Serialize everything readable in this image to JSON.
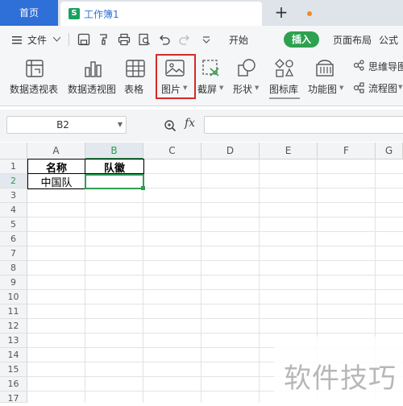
{
  "tabs": {
    "home": "首页",
    "document": "工作簿1",
    "document_icon": "S",
    "new_tab": "+"
  },
  "menu": {
    "file": "文件",
    "items": [
      "开始",
      "插入",
      "页面布局",
      "公式"
    ],
    "active": "插入"
  },
  "ribbon": {
    "pivot_table": "数据透视表",
    "pivot_chart": "数据透视图",
    "table": "表格",
    "picture": "图片",
    "screenshot": "截屏",
    "shapes": "形状",
    "icon_library": "图标库",
    "function_chart": "功能图",
    "mind_map": "思维导图",
    "flowchart": "流程图"
  },
  "formula_bar": {
    "cell_ref": "B2",
    "fx_label": "fx",
    "formula": ""
  },
  "sheet": {
    "columns": [
      "A",
      "B",
      "C",
      "D",
      "E",
      "F",
      "G"
    ],
    "selected_column": "B",
    "rows": [
      "1",
      "2",
      "3",
      "4",
      "5",
      "6",
      "7",
      "8",
      "9",
      "10",
      "11",
      "12",
      "13",
      "14",
      "15",
      "16",
      "17"
    ],
    "selected_row": "2",
    "cells": {
      "A1": "名称",
      "B1": "队徽",
      "A2": "中国队"
    }
  },
  "watermark": "软件技巧",
  "colors": {
    "accent_blue": "#2f6fd8",
    "insert_tab_green": "#2ea150",
    "selection_green": "#2f9d50",
    "highlight_red": "#d42a2a"
  }
}
